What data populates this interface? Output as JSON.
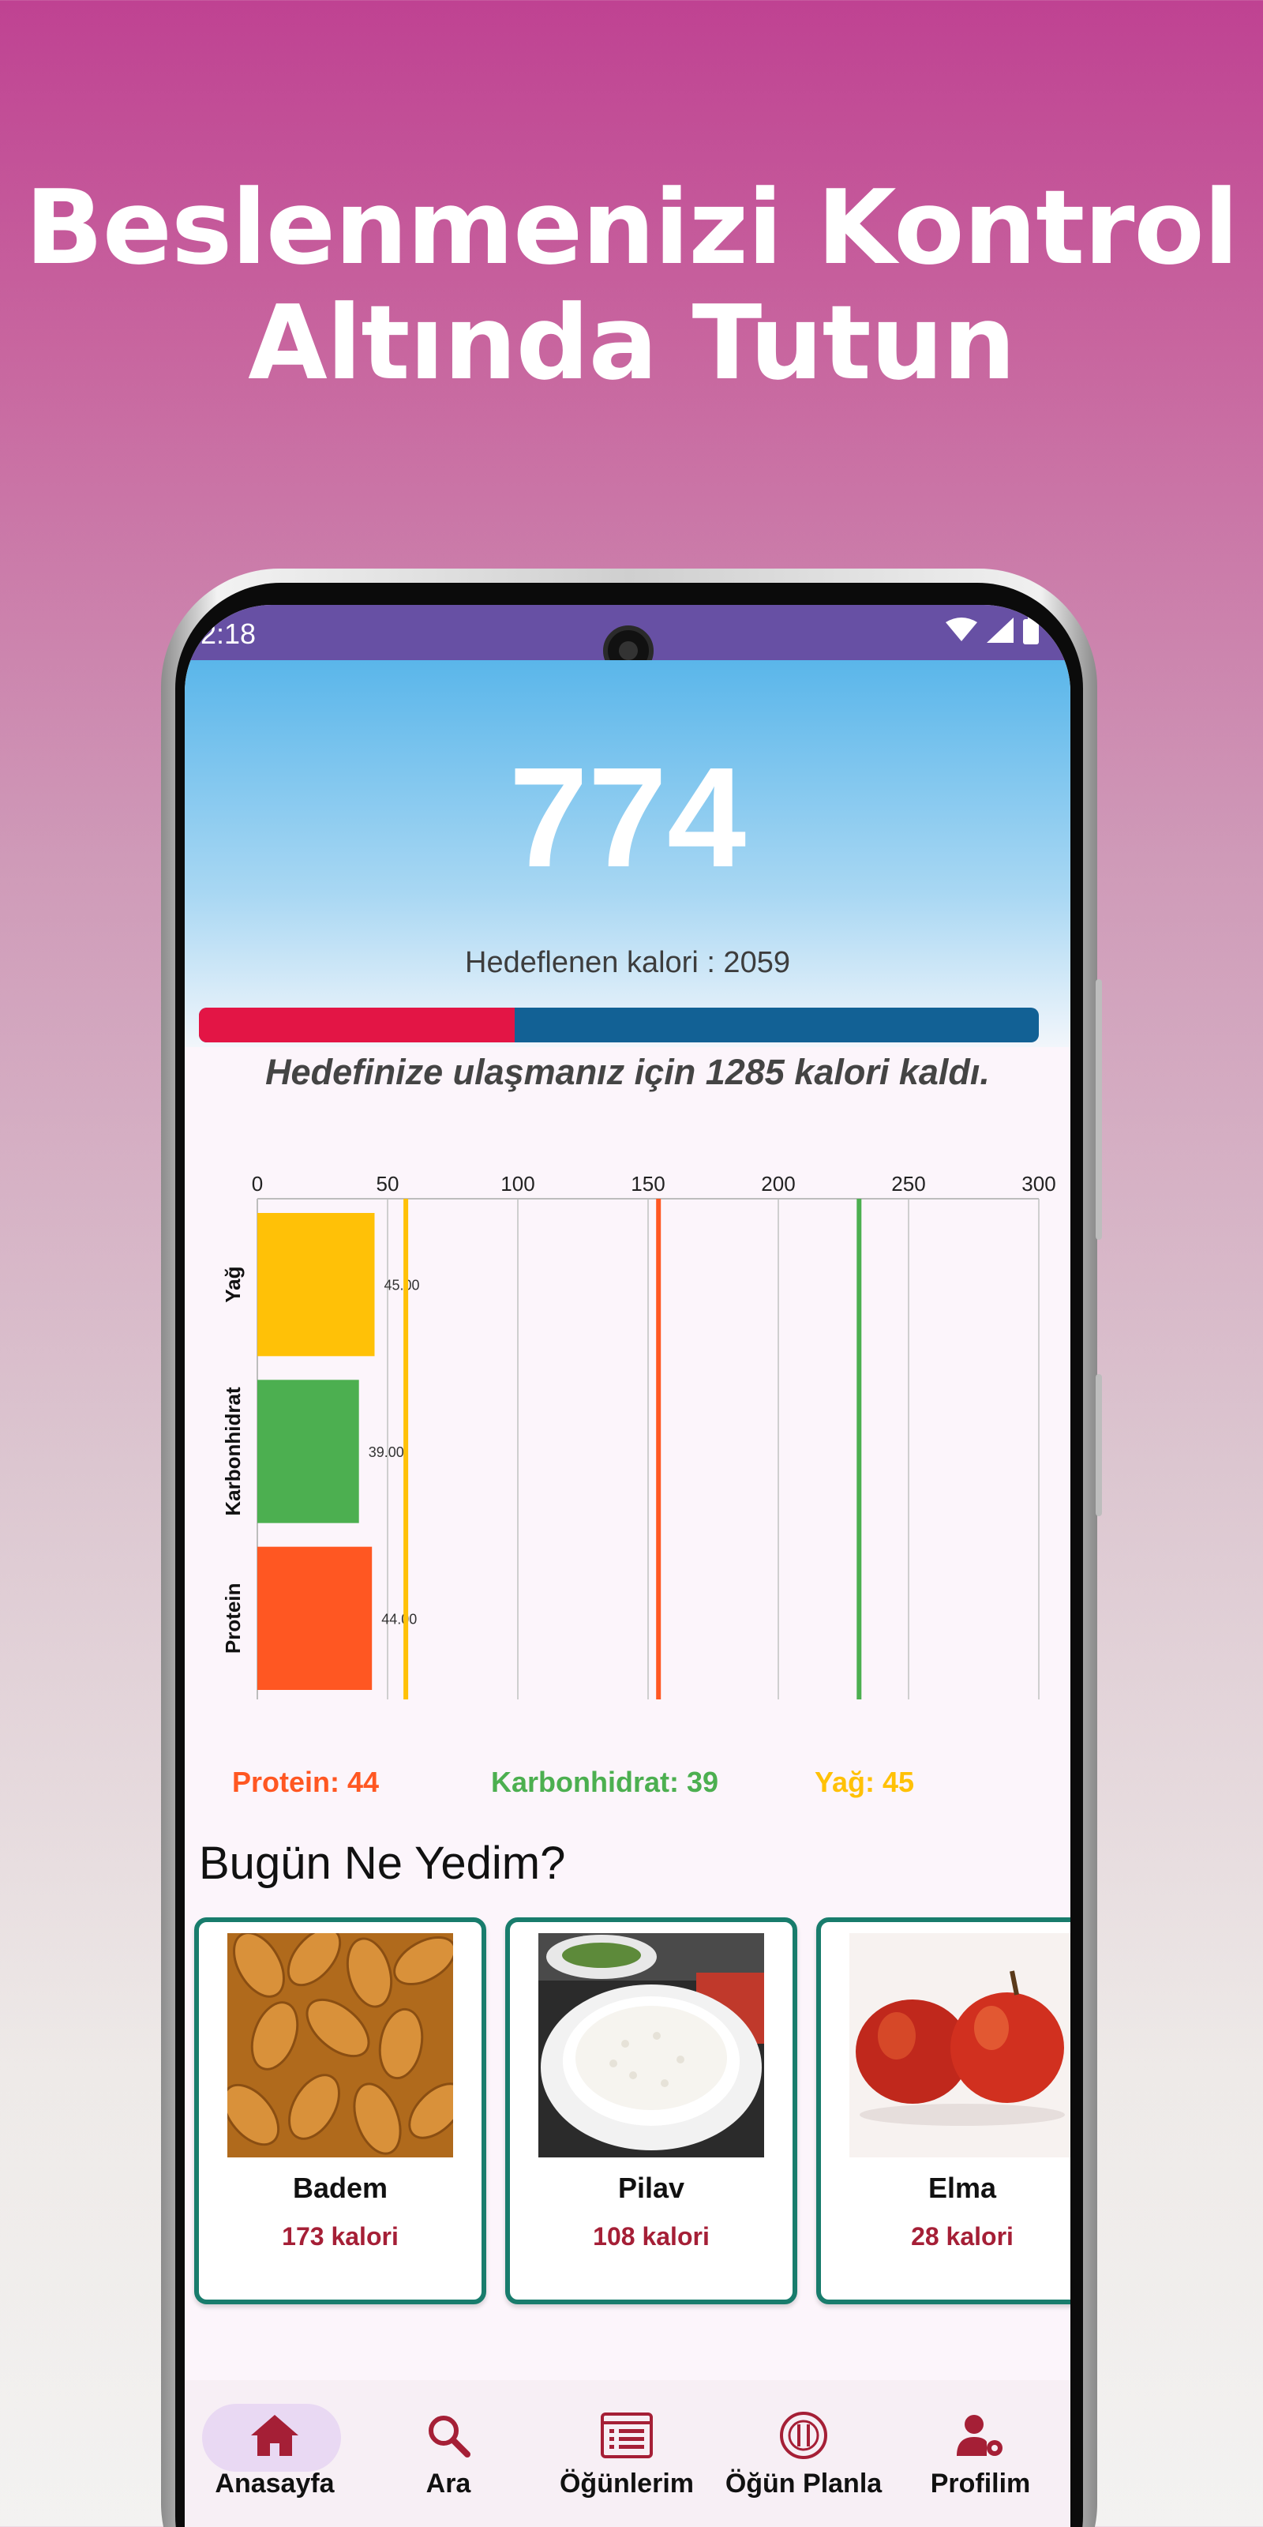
{
  "headline": {
    "line1": "Beslenmenizi Kontrol",
    "line2": "Altında Tutun"
  },
  "status_bar": {
    "time": "2:18"
  },
  "summary": {
    "consumed_calories": "774",
    "target_label": "Hedeflenen kalori : 2059",
    "progress_fraction": 0.376,
    "remaining_message": "Hedefinize ulaşmanız için 1285 kalori kaldı."
  },
  "colors": {
    "accent_purple": "#6750a4",
    "progress_fill": "#e31545",
    "progress_track": "#126195",
    "card_border": "#187c6c",
    "calorie_text": "#a51f36",
    "protein": "#ff5722",
    "carbohydrate": "#4caf50",
    "fat": "#ffc107"
  },
  "chart_data": {
    "type": "bar",
    "orientation": "horizontal",
    "categories": [
      "Yağ",
      "Karbonhidrat",
      "Protein"
    ],
    "values": [
      45,
      39,
      44
    ],
    "value_labels": [
      "45.00",
      "39.00",
      "44.00"
    ],
    "bar_colors": [
      "#ffc107",
      "#4caf50",
      "#ff5722"
    ],
    "xlim": [
      0,
      300
    ],
    "x_ticks": [
      0,
      50,
      100,
      150,
      200,
      250,
      300
    ],
    "target_lines": [
      {
        "value": 57,
        "color": "#ffc107"
      },
      {
        "value": 154,
        "color": "#ff5722"
      },
      {
        "value": 231,
        "color": "#4caf50"
      }
    ],
    "grid": true
  },
  "legend": {
    "protein": "Protein: 44",
    "carbohydrate": "Karbonhidrat: 39",
    "fat": "Yağ: 45"
  },
  "section_title": "Bugün Ne Yedim?",
  "foods": [
    {
      "name": "Badem",
      "calories": "173 kalori",
      "image": "almonds-photo"
    },
    {
      "name": "Pilav",
      "calories": "108 kalori",
      "image": "rice-bowl-photo"
    },
    {
      "name": "Elma",
      "calories": "28 kalori",
      "image": "apples-photo"
    }
  ],
  "nav": [
    {
      "label": "Anasayfa",
      "icon": "home-icon",
      "active": true
    },
    {
      "label": "Ara",
      "icon": "search-icon",
      "active": false
    },
    {
      "label": "Öğünlerim",
      "icon": "list-icon",
      "active": false
    },
    {
      "label": "Öğün Planla",
      "icon": "cutlery-plate-icon",
      "active": false
    },
    {
      "label": "Profilim",
      "icon": "user-settings-icon",
      "active": false
    }
  ]
}
